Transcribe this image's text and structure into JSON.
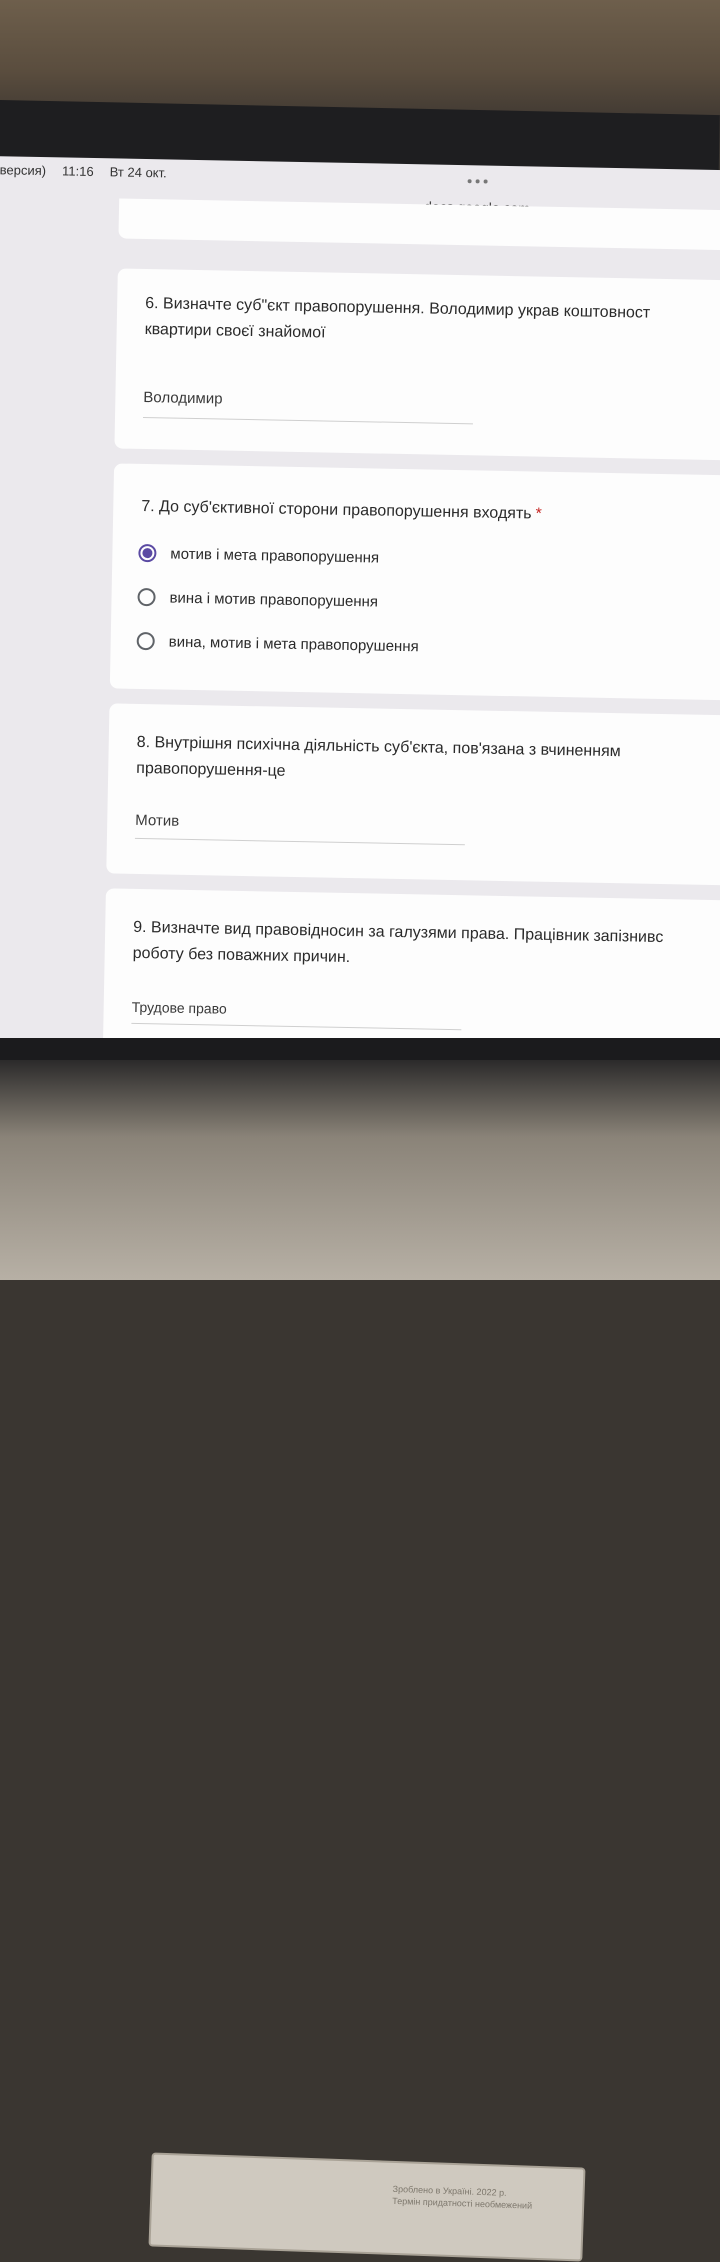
{
  "status_bar": {
    "app": "версия)",
    "time": "11:16",
    "date": "Вт 24 окт."
  },
  "browser": {
    "url": "docs.google.com"
  },
  "questions": [
    {
      "number_title": "6. Визначте суб\"єкт правопорушення. Володимир украв коштовност",
      "title_line2": "квартири своєї знайомої",
      "answer": "Володимир"
    },
    {
      "number_title": "7. До суб'єктивної сторони правопорушення входять",
      "required_mark": "*",
      "options": [
        {
          "label": "мотив і мета правопорушення",
          "selected": true
        },
        {
          "label": "вина і мотив правопорушення",
          "selected": false
        },
        {
          "label": "вина, мотив і мета правопорушення",
          "selected": false
        }
      ]
    },
    {
      "number_title": "8. Внутрішня психічна діяльність суб'єкта, пов'язана з вчиненням",
      "title_line2": "правопорушення-це",
      "answer": "Мотив"
    },
    {
      "number_title": "9. Визначте вид правовідносин за галузями права. Працівник запізнивс",
      "title_line2": "роботу без поважних причин.",
      "answer": "Трудове право"
    }
  ],
  "colors": {
    "accent": "#5b4aa3",
    "required": "#c5221f",
    "card": "#fdfdfd",
    "background": "#ebe9ed"
  },
  "background_paper": {
    "line1": "Зроблено в Україні. 2022 р.",
    "line2": "Термін придатності необмежений"
  }
}
